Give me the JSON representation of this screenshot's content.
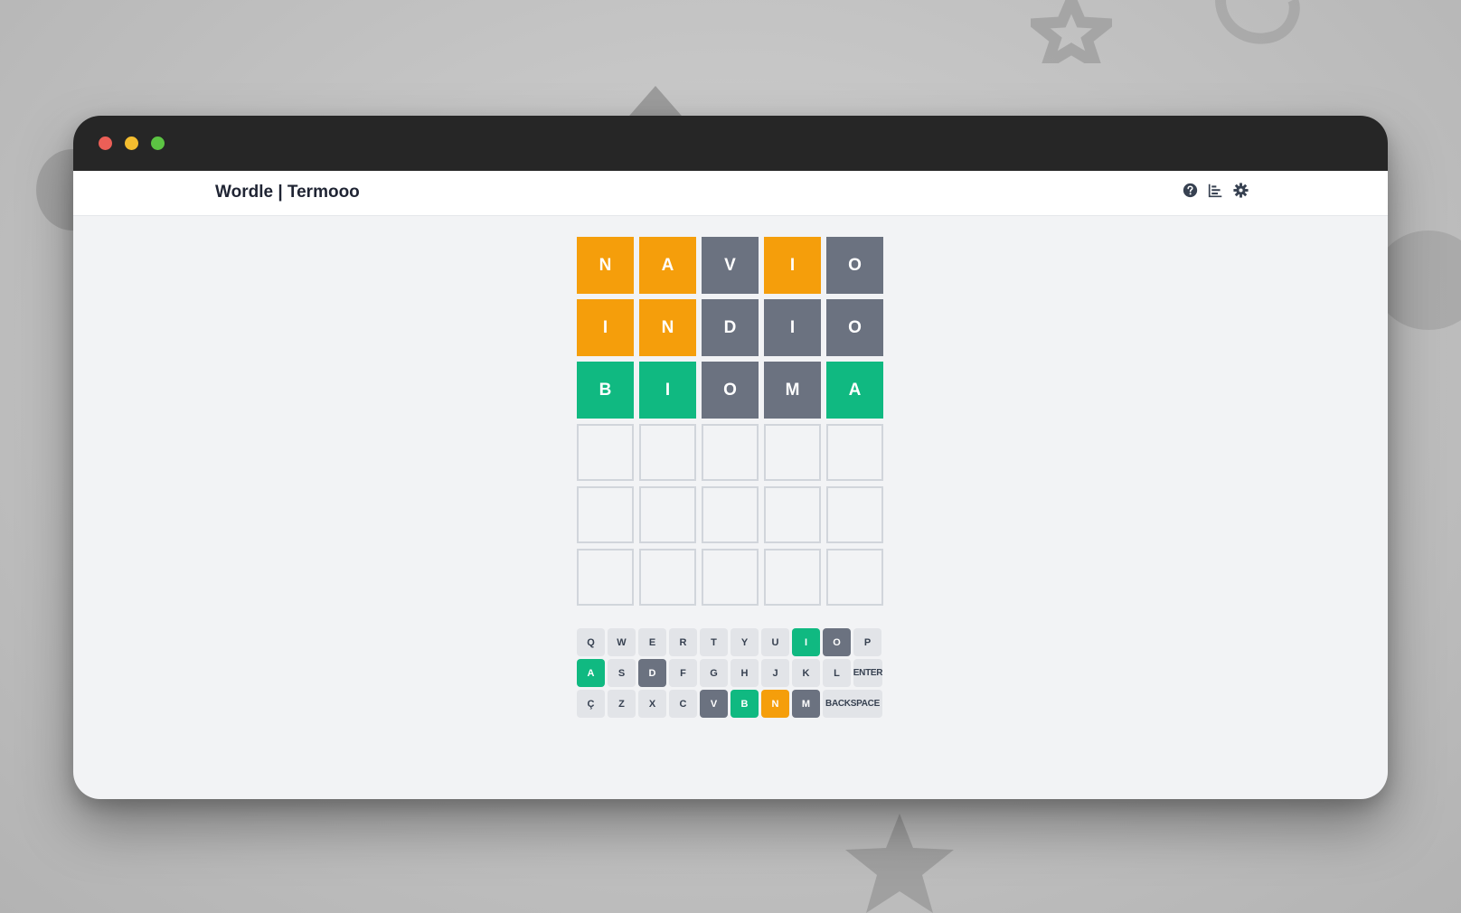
{
  "app": {
    "title": "Wordle | Termooo",
    "icons": [
      "question-circle-icon",
      "chart-bar-icon",
      "gear-icon"
    ]
  },
  "colors": {
    "present": "#f59e0b",
    "absent": "#6b7280",
    "correct": "#10b981",
    "titlebar": "#262626"
  },
  "board": {
    "rows": [
      [
        {
          "letter": "N",
          "state": "present"
        },
        {
          "letter": "A",
          "state": "present"
        },
        {
          "letter": "V",
          "state": "absent"
        },
        {
          "letter": "I",
          "state": "present"
        },
        {
          "letter": "O",
          "state": "absent"
        }
      ],
      [
        {
          "letter": "I",
          "state": "present"
        },
        {
          "letter": "N",
          "state": "present"
        },
        {
          "letter": "D",
          "state": "absent"
        },
        {
          "letter": "I",
          "state": "absent"
        },
        {
          "letter": "O",
          "state": "absent"
        }
      ],
      [
        {
          "letter": "B",
          "state": "correct"
        },
        {
          "letter": "I",
          "state": "correct"
        },
        {
          "letter": "O",
          "state": "absent"
        },
        {
          "letter": "M",
          "state": "absent"
        },
        {
          "letter": "A",
          "state": "correct"
        }
      ],
      [
        {
          "letter": "",
          "state": "empty"
        },
        {
          "letter": "",
          "state": "empty"
        },
        {
          "letter": "",
          "state": "empty"
        },
        {
          "letter": "",
          "state": "empty"
        },
        {
          "letter": "",
          "state": "empty"
        }
      ],
      [
        {
          "letter": "",
          "state": "empty"
        },
        {
          "letter": "",
          "state": "empty"
        },
        {
          "letter": "",
          "state": "empty"
        },
        {
          "letter": "",
          "state": "empty"
        },
        {
          "letter": "",
          "state": "empty"
        }
      ],
      [
        {
          "letter": "",
          "state": "empty"
        },
        {
          "letter": "",
          "state": "empty"
        },
        {
          "letter": "",
          "state": "empty"
        },
        {
          "letter": "",
          "state": "empty"
        },
        {
          "letter": "",
          "state": "empty"
        }
      ]
    ]
  },
  "keyboard": {
    "rows": [
      [
        {
          "label": "Q",
          "state": "default"
        },
        {
          "label": "W",
          "state": "default"
        },
        {
          "label": "E",
          "state": "default"
        },
        {
          "label": "R",
          "state": "default"
        },
        {
          "label": "T",
          "state": "default"
        },
        {
          "label": "Y",
          "state": "default"
        },
        {
          "label": "U",
          "state": "default"
        },
        {
          "label": "I",
          "state": "correct"
        },
        {
          "label": "O",
          "state": "absent"
        },
        {
          "label": "P",
          "state": "default"
        }
      ],
      [
        {
          "label": "A",
          "state": "correct"
        },
        {
          "label": "S",
          "state": "default"
        },
        {
          "label": "D",
          "state": "absent"
        },
        {
          "label": "F",
          "state": "default"
        },
        {
          "label": "G",
          "state": "default"
        },
        {
          "label": "H",
          "state": "default"
        },
        {
          "label": "J",
          "state": "default"
        },
        {
          "label": "K",
          "state": "default"
        },
        {
          "label": "L",
          "state": "default"
        },
        {
          "label": "ENTER",
          "state": "default"
        }
      ],
      [
        {
          "label": "Ç",
          "state": "default"
        },
        {
          "label": "Z",
          "state": "default"
        },
        {
          "label": "X",
          "state": "default"
        },
        {
          "label": "C",
          "state": "default"
        },
        {
          "label": "V",
          "state": "absent"
        },
        {
          "label": "B",
          "state": "correct"
        },
        {
          "label": "N",
          "state": "present"
        },
        {
          "label": "M",
          "state": "absent"
        },
        {
          "label": "BACKSPACE",
          "state": "default"
        }
      ]
    ]
  }
}
